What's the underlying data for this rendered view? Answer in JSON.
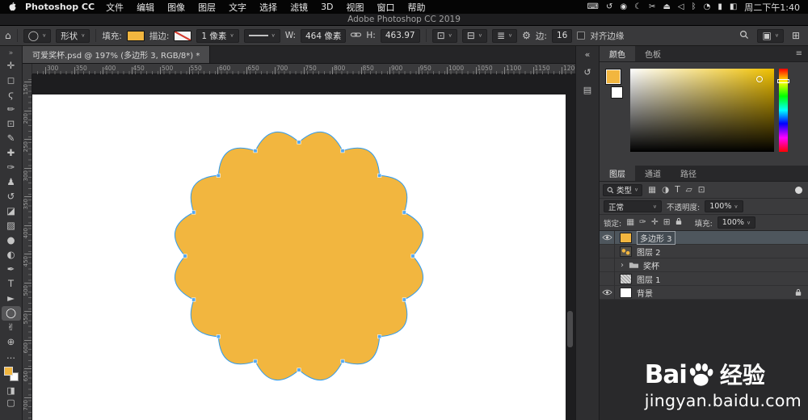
{
  "menu_bar": {
    "app_name": "Photoshop CC",
    "menus": [
      "文件",
      "编辑",
      "图像",
      "图层",
      "文字",
      "选择",
      "滤镜",
      "3D",
      "视图",
      "窗口",
      "帮助"
    ],
    "status_icons": [
      {
        "name": "keyboard-icon",
        "glyph": "⌨"
      },
      {
        "name": "sync-icon",
        "glyph": "↺"
      },
      {
        "name": "camera-icon",
        "glyph": "◉"
      },
      {
        "name": "moon-icon",
        "glyph": "☾"
      },
      {
        "name": "scissors-icon",
        "glyph": "✂"
      },
      {
        "name": "eject-icon",
        "glyph": "⏏"
      },
      {
        "name": "volume-icon",
        "glyph": "◁"
      },
      {
        "name": "bluetooth-icon",
        "glyph": "ᛒ"
      },
      {
        "name": "wifi-icon",
        "glyph": "◔"
      },
      {
        "name": "battery-icon",
        "glyph": "▮"
      },
      {
        "name": "control-center-icon",
        "glyph": "◧"
      }
    ],
    "clock": "周二下午1:40",
    "window_title": "Adobe Photoshop CC 2019"
  },
  "options_bar": {
    "tool_mode": "形状",
    "fill_label": "填充:",
    "stroke_label": "描边:",
    "stroke_width": "1 像素",
    "w_label": "W:",
    "w_value": "464 像素",
    "h_label": "H:",
    "h_value": "463.97",
    "sides_label": "边:",
    "sides_value": "16",
    "align_edges": "对齐边缘"
  },
  "document_tab": {
    "title": "可爱奖杯.psd @ 197% (多边形 3, RGB/8*) *"
  },
  "rulers": {
    "horizontal": [
      "300",
      "350",
      "400",
      "450",
      "500",
      "550",
      "600",
      "650",
      "700",
      "750",
      "800",
      "850",
      "900",
      "950",
      "1000",
      "1050",
      "1100",
      "1150",
      "1200"
    ],
    "vertical": [
      "150",
      "200",
      "250",
      "300",
      "350",
      "400",
      "450",
      "500",
      "550",
      "600",
      "650",
      "700"
    ]
  },
  "tools": [
    {
      "name": "move-tool",
      "glyph": "✛"
    },
    {
      "name": "marquee-tool",
      "glyph": "◻"
    },
    {
      "name": "lasso-tool",
      "glyph": "ϛ"
    },
    {
      "name": "quick-selection-tool",
      "glyph": "✏"
    },
    {
      "name": "crop-tool",
      "glyph": "⊡"
    },
    {
      "name": "eyedropper-tool",
      "glyph": "✎"
    },
    {
      "name": "healing-brush-tool",
      "glyph": "✚"
    },
    {
      "name": "brush-tool",
      "glyph": "✑"
    },
    {
      "name": "clone-stamp-tool",
      "glyph": "♟"
    },
    {
      "name": "history-brush-tool",
      "glyph": "↺"
    },
    {
      "name": "eraser-tool",
      "glyph": "◪"
    },
    {
      "name": "gradient-tool",
      "glyph": "▨"
    },
    {
      "name": "blur-tool",
      "glyph": "●"
    },
    {
      "name": "dodge-tool",
      "glyph": "◐"
    },
    {
      "name": "pen-tool",
      "glyph": "✒"
    },
    {
      "name": "type-tool",
      "glyph": "T"
    },
    {
      "name": "path-selection-tool",
      "glyph": "►"
    },
    {
      "name": "shape-tool",
      "glyph": "◯",
      "selected": true
    },
    {
      "name": "hand-tool",
      "glyph": "✌"
    },
    {
      "name": "zoom-tool",
      "glyph": "⊕"
    }
  ],
  "toolbar_extras": {
    "collapse": "»",
    "ellipsis": "…",
    "quick_mask": "◨",
    "screen_mode": "▢"
  },
  "dock_icons": [
    {
      "name": "collapse-dock-icon",
      "glyph": "«"
    },
    {
      "name": "history-panel-icon",
      "glyph": "↺"
    },
    {
      "name": "properties-panel-icon",
      "glyph": "▤"
    }
  ],
  "icons": {
    "home": "⌂",
    "caret": "∨",
    "tool_preset": "◯",
    "combine": "⊡",
    "align": "⊟",
    "arrange": "≣",
    "gear": "⚙",
    "workspace": "▣",
    "extras": "⊞",
    "hamburger": "≡",
    "group_caret": "›",
    "filter_pixel": "▦",
    "filter_adjust": "◑",
    "filter_type": "T",
    "filter_shape": "▱",
    "filter_smart": "⊡",
    "lock_transparent": "▦",
    "lock_pixels": "✑",
    "lock_position": "✛",
    "lock_artboard": "⊞"
  },
  "color_panel": {
    "tabs": [
      "颜色",
      "色板"
    ],
    "active_tab": "颜色"
  },
  "layers_panel": {
    "tabs": [
      "图层",
      "通道",
      "路径"
    ],
    "active_tab": "图层",
    "filter_label": "类型",
    "blend_mode": "正常",
    "opacity_label": "不透明度:",
    "opacity_value": "100%",
    "lock_label": "锁定:",
    "fill_label": "填充:",
    "fill_value": "100%",
    "layers": [
      {
        "name": "多边形 3",
        "visible": true,
        "selected": true,
        "kind": "shape"
      },
      {
        "name": "图层 2",
        "visible": false,
        "kind": "pixel"
      },
      {
        "name": "奖杯",
        "visible": false,
        "kind": "group"
      },
      {
        "name": "图层 1",
        "visible": false,
        "kind": "pixel"
      },
      {
        "name": "背景",
        "visible": true,
        "locked": true,
        "kind": "background"
      }
    ]
  },
  "watermark": {
    "latin": "Bai",
    "cn": "经验",
    "url": "jingyan.baidu.com"
  },
  "colors": {
    "shape_fill": "#F2B63F",
    "path_stroke": "#2F9BF0",
    "anchor_fill": "#53A7F0",
    "swatch_yellow": "#F2B63F",
    "canvas_bg": "#FFFFFF"
  }
}
